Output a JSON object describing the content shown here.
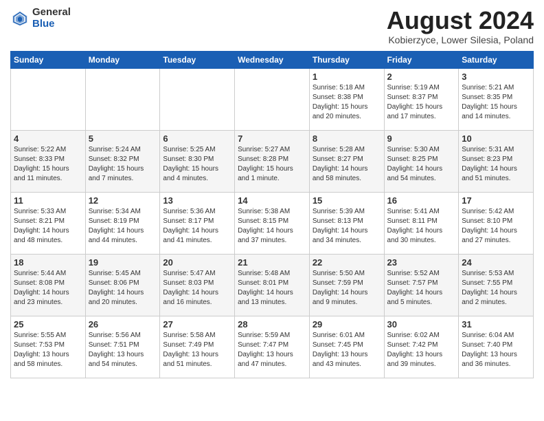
{
  "header": {
    "logo_general": "General",
    "logo_blue": "Blue",
    "month_title": "August 2024",
    "subtitle": "Kobierzyce, Lower Silesia, Poland"
  },
  "days_of_week": [
    "Sunday",
    "Monday",
    "Tuesday",
    "Wednesday",
    "Thursday",
    "Friday",
    "Saturday"
  ],
  "weeks": [
    [
      {
        "day": "",
        "text": ""
      },
      {
        "day": "",
        "text": ""
      },
      {
        "day": "",
        "text": ""
      },
      {
        "day": "",
        "text": ""
      },
      {
        "day": "1",
        "text": "Sunrise: 5:18 AM\nSunset: 8:38 PM\nDaylight: 15 hours\nand 20 minutes."
      },
      {
        "day": "2",
        "text": "Sunrise: 5:19 AM\nSunset: 8:37 PM\nDaylight: 15 hours\nand 17 minutes."
      },
      {
        "day": "3",
        "text": "Sunrise: 5:21 AM\nSunset: 8:35 PM\nDaylight: 15 hours\nand 14 minutes."
      }
    ],
    [
      {
        "day": "4",
        "text": "Sunrise: 5:22 AM\nSunset: 8:33 PM\nDaylight: 15 hours\nand 11 minutes."
      },
      {
        "day": "5",
        "text": "Sunrise: 5:24 AM\nSunset: 8:32 PM\nDaylight: 15 hours\nand 7 minutes."
      },
      {
        "day": "6",
        "text": "Sunrise: 5:25 AM\nSunset: 8:30 PM\nDaylight: 15 hours\nand 4 minutes."
      },
      {
        "day": "7",
        "text": "Sunrise: 5:27 AM\nSunset: 8:28 PM\nDaylight: 15 hours\nand 1 minute."
      },
      {
        "day": "8",
        "text": "Sunrise: 5:28 AM\nSunset: 8:27 PM\nDaylight: 14 hours\nand 58 minutes."
      },
      {
        "day": "9",
        "text": "Sunrise: 5:30 AM\nSunset: 8:25 PM\nDaylight: 14 hours\nand 54 minutes."
      },
      {
        "day": "10",
        "text": "Sunrise: 5:31 AM\nSunset: 8:23 PM\nDaylight: 14 hours\nand 51 minutes."
      }
    ],
    [
      {
        "day": "11",
        "text": "Sunrise: 5:33 AM\nSunset: 8:21 PM\nDaylight: 14 hours\nand 48 minutes."
      },
      {
        "day": "12",
        "text": "Sunrise: 5:34 AM\nSunset: 8:19 PM\nDaylight: 14 hours\nand 44 minutes."
      },
      {
        "day": "13",
        "text": "Sunrise: 5:36 AM\nSunset: 8:17 PM\nDaylight: 14 hours\nand 41 minutes."
      },
      {
        "day": "14",
        "text": "Sunrise: 5:38 AM\nSunset: 8:15 PM\nDaylight: 14 hours\nand 37 minutes."
      },
      {
        "day": "15",
        "text": "Sunrise: 5:39 AM\nSunset: 8:13 PM\nDaylight: 14 hours\nand 34 minutes."
      },
      {
        "day": "16",
        "text": "Sunrise: 5:41 AM\nSunset: 8:11 PM\nDaylight: 14 hours\nand 30 minutes."
      },
      {
        "day": "17",
        "text": "Sunrise: 5:42 AM\nSunset: 8:10 PM\nDaylight: 14 hours\nand 27 minutes."
      }
    ],
    [
      {
        "day": "18",
        "text": "Sunrise: 5:44 AM\nSunset: 8:08 PM\nDaylight: 14 hours\nand 23 minutes."
      },
      {
        "day": "19",
        "text": "Sunrise: 5:45 AM\nSunset: 8:06 PM\nDaylight: 14 hours\nand 20 minutes."
      },
      {
        "day": "20",
        "text": "Sunrise: 5:47 AM\nSunset: 8:03 PM\nDaylight: 14 hours\nand 16 minutes."
      },
      {
        "day": "21",
        "text": "Sunrise: 5:48 AM\nSunset: 8:01 PM\nDaylight: 14 hours\nand 13 minutes."
      },
      {
        "day": "22",
        "text": "Sunrise: 5:50 AM\nSunset: 7:59 PM\nDaylight: 14 hours\nand 9 minutes."
      },
      {
        "day": "23",
        "text": "Sunrise: 5:52 AM\nSunset: 7:57 PM\nDaylight: 14 hours\nand 5 minutes."
      },
      {
        "day": "24",
        "text": "Sunrise: 5:53 AM\nSunset: 7:55 PM\nDaylight: 14 hours\nand 2 minutes."
      }
    ],
    [
      {
        "day": "25",
        "text": "Sunrise: 5:55 AM\nSunset: 7:53 PM\nDaylight: 13 hours\nand 58 minutes."
      },
      {
        "day": "26",
        "text": "Sunrise: 5:56 AM\nSunset: 7:51 PM\nDaylight: 13 hours\nand 54 minutes."
      },
      {
        "day": "27",
        "text": "Sunrise: 5:58 AM\nSunset: 7:49 PM\nDaylight: 13 hours\nand 51 minutes."
      },
      {
        "day": "28",
        "text": "Sunrise: 5:59 AM\nSunset: 7:47 PM\nDaylight: 13 hours\nand 47 minutes."
      },
      {
        "day": "29",
        "text": "Sunrise: 6:01 AM\nSunset: 7:45 PM\nDaylight: 13 hours\nand 43 minutes."
      },
      {
        "day": "30",
        "text": "Sunrise: 6:02 AM\nSunset: 7:42 PM\nDaylight: 13 hours\nand 39 minutes."
      },
      {
        "day": "31",
        "text": "Sunrise: 6:04 AM\nSunset: 7:40 PM\nDaylight: 13 hours\nand 36 minutes."
      }
    ]
  ]
}
